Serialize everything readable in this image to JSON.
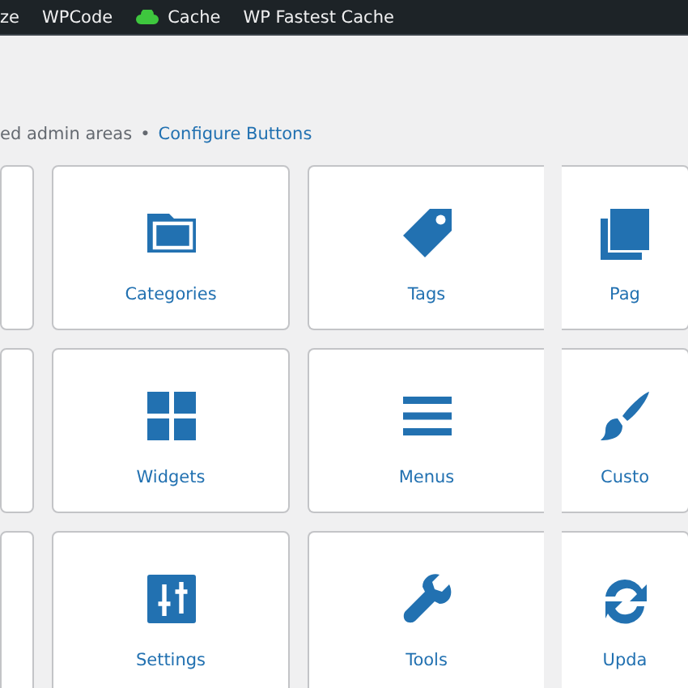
{
  "admin_bar": {
    "items": [
      {
        "label": "ze",
        "kind": "text"
      },
      {
        "label": "WPCode",
        "kind": "text"
      },
      {
        "label": "Cache",
        "kind": "cloud"
      },
      {
        "label": "WP Fastest Cache",
        "kind": "text"
      }
    ]
  },
  "intro": {
    "text": "ed admin areas",
    "separator": "•",
    "link": "Configure Buttons"
  },
  "buttons": [
    {
      "kind": "blank"
    },
    {
      "kind": "folder",
      "label": "Categories"
    },
    {
      "kind": "tag",
      "label": "Tags"
    },
    {
      "kind": "pages",
      "label": "Pag"
    },
    {
      "kind": "blank"
    },
    {
      "kind": "grid",
      "label": "Widgets"
    },
    {
      "kind": "menu",
      "label": "Menus"
    },
    {
      "kind": "brush",
      "label": "Custo"
    },
    {
      "kind": "blank"
    },
    {
      "kind": "sliders",
      "label": "Settings"
    },
    {
      "kind": "wrench",
      "label": "Tools"
    },
    {
      "kind": "refresh",
      "label": "Upda"
    }
  ]
}
